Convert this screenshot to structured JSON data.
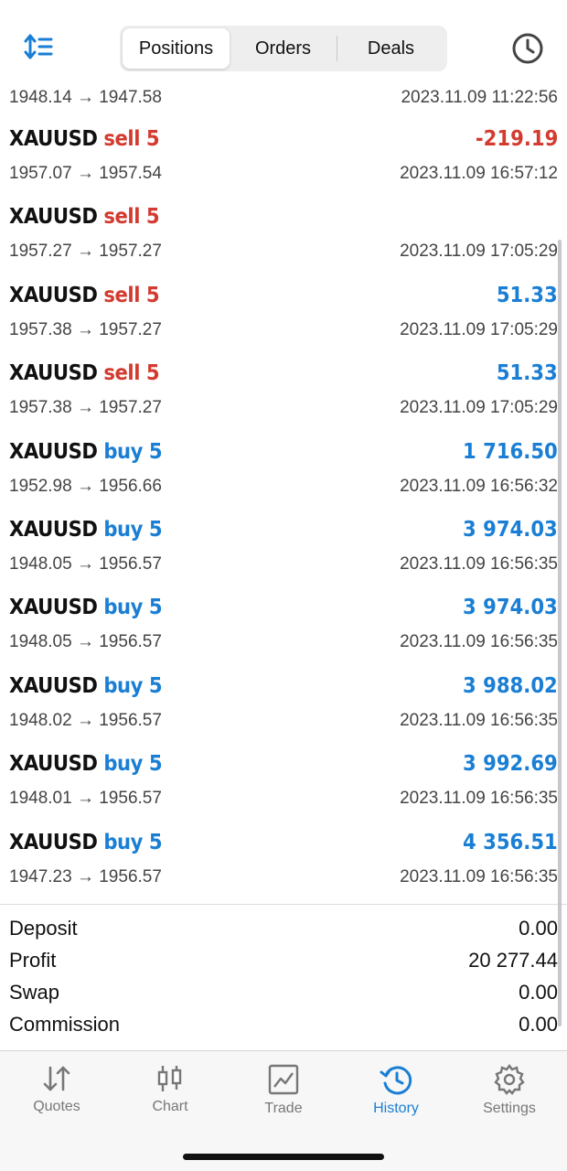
{
  "segments": [
    {
      "label": "Positions",
      "active": true
    },
    {
      "label": "Orders",
      "active": false
    },
    {
      "label": "Deals",
      "active": false
    }
  ],
  "partial_row": {
    "prices": "1948.14 → 1947.58",
    "time": "2023.11.09 11:22:56"
  },
  "deals": [
    {
      "symbol": "XAUUSD",
      "side": "sell 5",
      "type": "sell",
      "profit": "-219.19",
      "prices": "1957.07 → 1957.54",
      "time": "2023.11.09 16:57:12"
    },
    {
      "symbol": "XAUUSD",
      "side": "sell 5",
      "type": "sell",
      "profit": "",
      "prices": "1957.27 → 1957.27",
      "time": "2023.11.09 17:05:29"
    },
    {
      "symbol": "XAUUSD",
      "side": "sell 5",
      "type": "sell",
      "profit": "51.33",
      "prices": "1957.38 → 1957.27",
      "time": "2023.11.09 17:05:29"
    },
    {
      "symbol": "XAUUSD",
      "side": "sell 5",
      "type": "sell",
      "profit": "51.33",
      "prices": "1957.38 → 1957.27",
      "time": "2023.11.09 17:05:29"
    },
    {
      "symbol": "XAUUSD",
      "side": "buy 5",
      "type": "buy",
      "profit": "1 716.50",
      "prices": "1952.98 → 1956.66",
      "time": "2023.11.09 16:56:32"
    },
    {
      "symbol": "XAUUSD",
      "side": "buy 5",
      "type": "buy",
      "profit": "3 974.03",
      "prices": "1948.05 → 1956.57",
      "time": "2023.11.09 16:56:35"
    },
    {
      "symbol": "XAUUSD",
      "side": "buy 5",
      "type": "buy",
      "profit": "3 974.03",
      "prices": "1948.05 → 1956.57",
      "time": "2023.11.09 16:56:35"
    },
    {
      "symbol": "XAUUSD",
      "side": "buy 5",
      "type": "buy",
      "profit": "3 988.02",
      "prices": "1948.02 → 1956.57",
      "time": "2023.11.09 16:56:35"
    },
    {
      "symbol": "XAUUSD",
      "side": "buy 5",
      "type": "buy",
      "profit": "3 992.69",
      "prices": "1948.01 → 1956.57",
      "time": "2023.11.09 16:56:35"
    },
    {
      "symbol": "XAUUSD",
      "side": "buy 5",
      "type": "buy",
      "profit": "4 356.51",
      "prices": "1947.23 → 1956.57",
      "time": "2023.11.09 16:56:35"
    }
  ],
  "summary": [
    {
      "label": "Deposit",
      "value": "0.00"
    },
    {
      "label": "Profit",
      "value": "20 277.44"
    },
    {
      "label": "Swap",
      "value": "0.00"
    },
    {
      "label": "Commission",
      "value": "0.00"
    }
  ],
  "tabs": [
    {
      "label": "Quotes",
      "icon": "quotes-icon",
      "active": false
    },
    {
      "label": "Chart",
      "icon": "candlestick-icon",
      "active": false
    },
    {
      "label": "Trade",
      "icon": "trade-chart-icon",
      "active": false
    },
    {
      "label": "History",
      "icon": "history-icon",
      "active": true
    },
    {
      "label": "Settings",
      "icon": "gear-icon",
      "active": false
    }
  ],
  "colors": {
    "accent": "#1a7fd4",
    "sell": "#d33b30",
    "buy": "#1a7fd4",
    "inactive_tab": "#777777"
  }
}
